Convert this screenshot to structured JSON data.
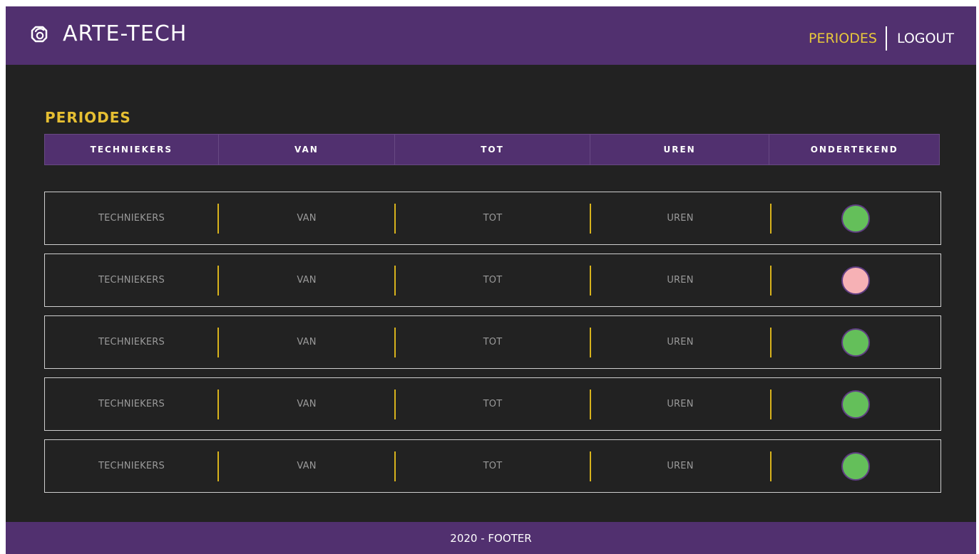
{
  "header": {
    "brand_name": "ARTE-TECH",
    "logo_icon": "circle-hexagon-logo-icon",
    "nav": {
      "periodes": "PERIODES",
      "logout": "LOGOUT"
    }
  },
  "main": {
    "section_title": "PERIODES",
    "table": {
      "headers": [
        "TECHNIEKERS",
        "VAN",
        "TOT",
        "UREN",
        "ONDERTEKEND"
      ],
      "rows": [
        {
          "techniekers": "TECHNIEKERS",
          "van": "VAN",
          "tot": "TOT",
          "uren": "UREN",
          "status_color": "#64bf5a"
        },
        {
          "techniekers": "TECHNIEKERS",
          "van": "VAN",
          "tot": "TOT",
          "uren": "UREN",
          "status_color": "#f6b1b5"
        },
        {
          "techniekers": "TECHNIEKERS",
          "van": "VAN",
          "tot": "TOT",
          "uren": "UREN",
          "status_color": "#64bf5a"
        },
        {
          "techniekers": "TECHNIEKERS",
          "van": "VAN",
          "tot": "TOT",
          "uren": "UREN",
          "status_color": "#64bf5a"
        },
        {
          "techniekers": "TECHNIEKERS",
          "van": "VAN",
          "tot": "TOT",
          "uren": "UREN",
          "status_color": "#64bf5a"
        }
      ]
    }
  },
  "footer": {
    "text": "2020 - FOOTER"
  },
  "colors": {
    "header_background": "#51306f",
    "page_background": "#222222",
    "accent_gold": "#e6bf32",
    "signed_green": "#64bf5a",
    "unsigned_pink": "#f6b1b5",
    "status_border": "#5f3d82"
  }
}
